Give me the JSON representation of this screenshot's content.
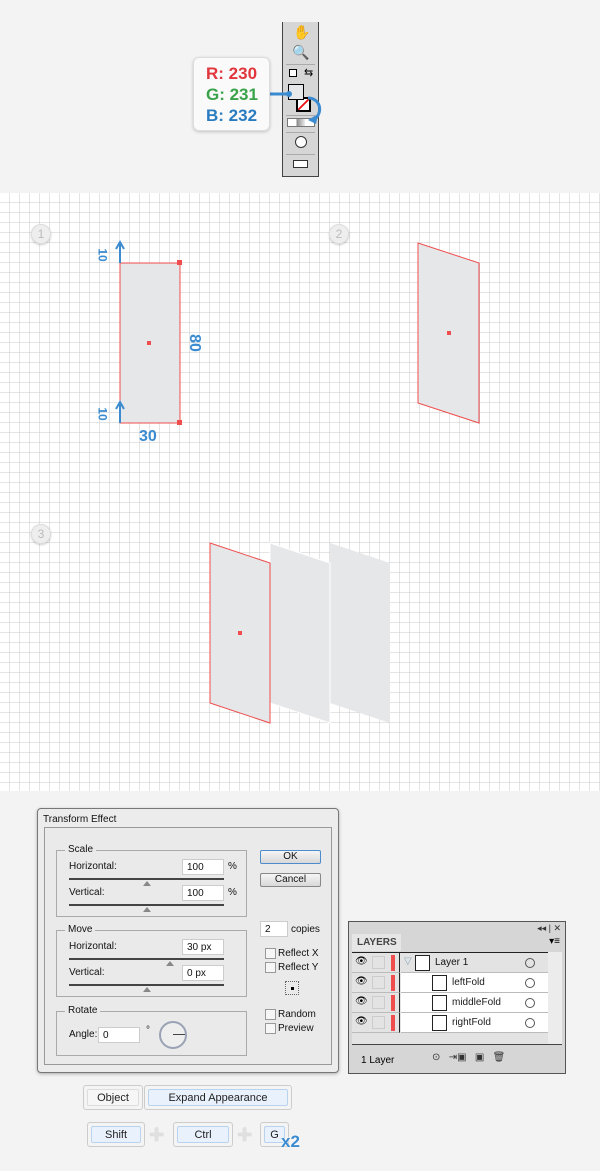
{
  "color_callout": {
    "r": "R: 230",
    "g": "G: 231",
    "b": "B: 232",
    "r_color": "#e1363c",
    "g_color": "#3aa34a",
    "b_color": "#2a7cc0"
  },
  "fill_color": "#e6e7e8",
  "steps": [
    "1",
    "2",
    "3"
  ],
  "dimensions": {
    "top": "10",
    "bottom": "10",
    "height": "80",
    "width": "30"
  },
  "transform_dialog": {
    "title": "Transform Effect",
    "scale_label": "Scale",
    "scale_h_label": "Horizontal:",
    "scale_h": "100",
    "scale_v_label": "Vertical:",
    "scale_v": "100",
    "pct": "%",
    "move_label": "Move",
    "move_h_label": "Horizontal:",
    "move_h": "30 px",
    "move_v_label": "Vertical:",
    "move_v": "0 px",
    "rotate_label": "Rotate",
    "angle_label": "Angle:",
    "angle": "0",
    "degree": "°",
    "ok": "OK",
    "cancel": "Cancel",
    "copies": "2",
    "copies_label": "copies",
    "reflect_x": "Reflect X",
    "reflect_y": "Reflect Y",
    "random": "Random",
    "preview": "Preview"
  },
  "layers_panel": {
    "tab": "LAYERS",
    "layers": [
      {
        "name": "Layer 1"
      },
      {
        "name": "leftFold"
      },
      {
        "name": "middleFold"
      },
      {
        "name": "rightFold"
      }
    ],
    "count": "1 Layer"
  },
  "menu_path": [
    "Object",
    "Expand Appearance"
  ],
  "shortcut": {
    "keys": [
      "Shift",
      "Ctrl",
      "G"
    ],
    "repeat": "x2"
  }
}
